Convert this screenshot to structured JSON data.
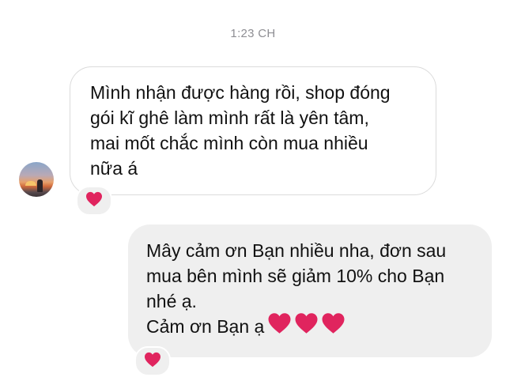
{
  "conversation": {
    "timestamp": "1:23 CH"
  },
  "messages": [
    {
      "sender": "customer",
      "lines": [
        "Mình nhận được hàng rồi, shop đóng",
        "gói kĩ ghê làm mình rất là yên tâm,",
        "mai mốt chắc mình còn mua nhiều",
        "nữa á"
      ],
      "reaction": "red-heart-icon"
    },
    {
      "sender": "shop",
      "lines": [
        "Mây cảm ơn Bạn nhiều nha, đơn sau",
        "mua bên mình sẽ giảm 10% cho Bạn",
        "nhé ạ.",
        "Cảm ơn Bạn ạ"
      ],
      "trailing_icons": [
        "red-heart-icon",
        "red-heart-icon",
        "red-heart-icon"
      ],
      "reaction": "red-heart-icon"
    }
  ],
  "colors": {
    "heart": "#e0245e",
    "incoming_bubble_border": "#dbdbdb",
    "outgoing_bubble_bg": "#efefef",
    "timestamp_text": "#8e8e93"
  }
}
